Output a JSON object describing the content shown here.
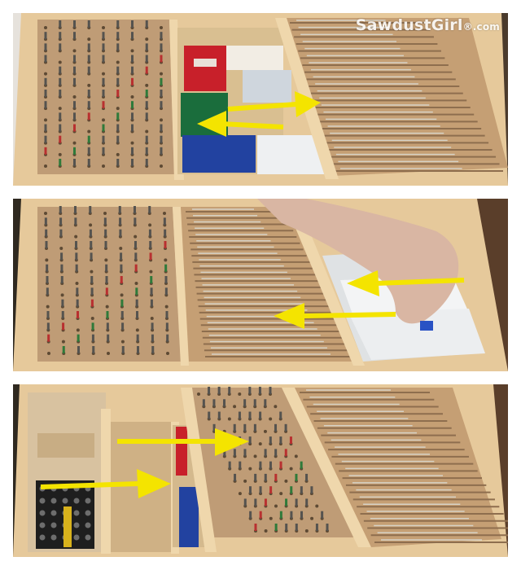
{
  "watermark": {
    "brand": "SawdustGirl",
    "suffix": "®.com"
  },
  "colors": {
    "arrow": "#f4e400",
    "arrow_stroke": "#7a7000",
    "pegboard": "#b99672",
    "plywood": "#e2c79a",
    "drill_bit_box": "#cfa77a"
  },
  "panels": [
    {
      "name": "panel-drawer-top",
      "arrows": [
        {
          "name": "arrow-right",
          "direction": "right"
        },
        {
          "name": "arrow-left",
          "direction": "left"
        }
      ]
    },
    {
      "name": "panel-drawer-middle",
      "arrows": [
        {
          "name": "arrow-left-upper",
          "direction": "left"
        },
        {
          "name": "arrow-left-lower",
          "direction": "left"
        }
      ]
    },
    {
      "name": "panel-drawer-bottom",
      "arrows": [
        {
          "name": "arrow-right-upper",
          "direction": "right"
        },
        {
          "name": "arrow-right-lower",
          "direction": "right"
        }
      ]
    }
  ]
}
